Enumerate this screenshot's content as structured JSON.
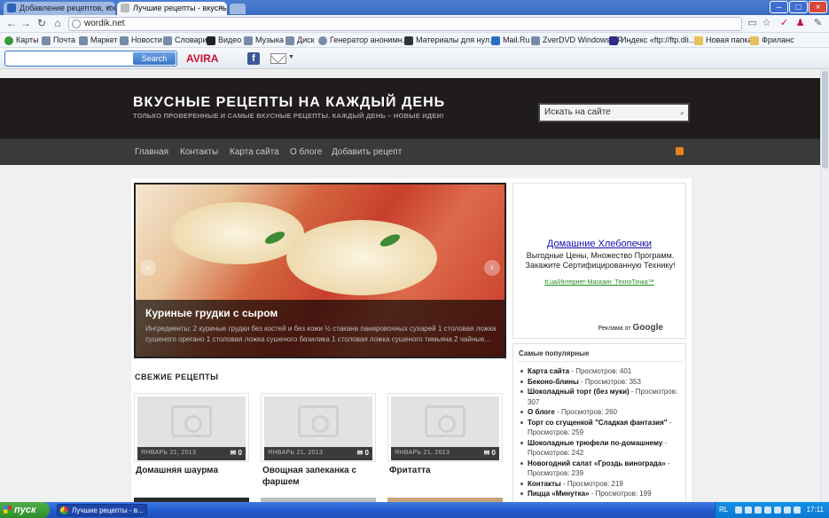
{
  "browser": {
    "tabs": [
      {
        "title": "Добавление рецептов, конт",
        "active": false
      },
      {
        "title": "Лучшие рецепты - вкусные",
        "active": true
      }
    ],
    "address": "wordik.net",
    "bookmarks": [
      "Карты",
      "Почта",
      "Маркет",
      "Новости",
      "Словари",
      "Видео",
      "Музыка",
      "Диск",
      "Генератор анонимн...",
      "Материалы для нул...",
      "Mail.Ru",
      "ZverDVD Windows XP",
      "Индекс «ftp://ftp.dli...",
      "Новая папка",
      "Фриланс"
    ],
    "ext_search_button": "Search",
    "avira_label": "AVIRA",
    "fb_label": "f"
  },
  "site": {
    "title": "ВКУСНЫЕ РЕЦЕПТЫ НА КАЖДЫЙ ДЕНЬ",
    "tagline": "ТОЛЬКО ПРОВЕРЕННЫЕ И САМЫЕ ВКУСНЫЕ РЕЦЕПТЫ. КАЖДЫЙ ДЕНЬ – НОВЫЕ ИДЕИ!",
    "search_placeholder": "Искать на сайте",
    "nav": [
      "Главная",
      "Контакты",
      "Карта сайта",
      "О блоге",
      "Добавить рецепт"
    ]
  },
  "slider": {
    "title": "Куриные грудки с сыром",
    "text": "Ингредиенты: 2 куриные грудки без костей и без кожи ½ стакана панировочных сухарей 1 столовая ложка сушеного орегано 1 столовая ложка сушеного базилика 1 столовая ложка сушеного тимьяна 2 чайные..."
  },
  "fresh": {
    "heading": "СВЕЖИЕ РЕЦЕПТЫ",
    "cards": [
      {
        "date": "ЯНВАРЬ 21, 2013",
        "comments": "0",
        "title": "Домашняя шаурма"
      },
      {
        "date": "ЯНВАРЬ 21, 2013",
        "comments": "0",
        "title": "Овощная запеканка с фаршем"
      },
      {
        "date": "ЯНВАРЬ 21, 2013",
        "comments": "0",
        "title": "Фритатта"
      }
    ]
  },
  "ad": {
    "title": "Домашние Хлебопечки",
    "text": "Выгодные Цены, Множество Программ. Закажите Сертифицированную Технику!",
    "url": "tt.ua/Интернет-Магазин_ТехноТочка™",
    "by_label": "Реклама от",
    "google": "Google"
  },
  "popular": {
    "heading": "Самые популярные",
    "items": [
      {
        "name": "Карта сайта",
        "views": " - Просмотров: 401"
      },
      {
        "name": "Беконо-блины",
        "views": " - Просмотров: 353"
      },
      {
        "name": "Шоколадный торт (без муки)",
        "views": " - Просмотров: 307"
      },
      {
        "name": "О блоге",
        "views": " - Просмотров: 260"
      },
      {
        "name": "Торт со сгущенкой \"Сладкая фантазия\"",
        "views": " - Просмотров: 259"
      },
      {
        "name": "Шоколадные трюфели по-домашнему",
        "views": " - Просмотров: 242"
      },
      {
        "name": "Новогодний салат «Гроздь винограда»",
        "views": " - Просмотров: 239"
      },
      {
        "name": "Контакты",
        "views": " - Просмотров: 219"
      },
      {
        "name": "Пицца «Минутка»",
        "views": " - Просмотров: 199"
      }
    ]
  },
  "taskbar": {
    "start": "пуск",
    "task": "Лучшие рецепты - в...",
    "lang": "RL",
    "clock": "17:11"
  }
}
